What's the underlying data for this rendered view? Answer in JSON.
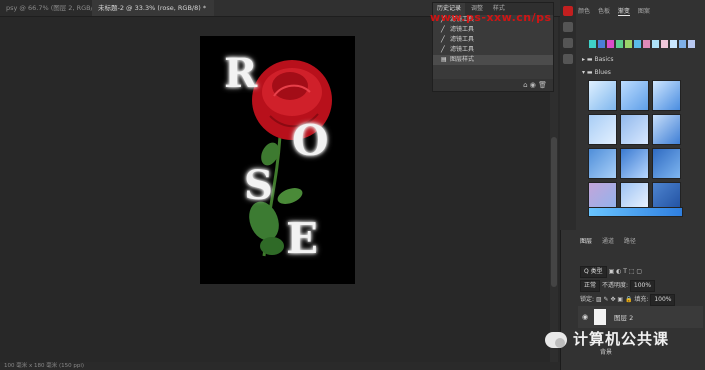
{
  "tabs": [
    "psy @ 66.7% (图层 2, RGB/8#)",
    "未标题-2 @ 33.3% (rose, RGB/8) *"
  ],
  "status": "100 毫米 x 180 毫米 (150 ppi)",
  "watermark": "www.ps-xxw.cn/ps",
  "history": {
    "tabs": [
      "历史记录",
      "调整",
      "样式"
    ],
    "items": [
      "滤镜工具",
      "滤镜工具",
      "滤镜工具",
      "滤镜工具"
    ],
    "selected": "图层样式",
    "footer": "⌂ ◉ 🗑"
  },
  "swatches": {
    "tabs": [
      "颜色",
      "色板",
      "渐变",
      "图案"
    ],
    "folders": [
      "Basics",
      "Blues"
    ]
  },
  "layers": {
    "tabs": [
      "图层",
      "通道",
      "路径"
    ],
    "kind_label": "Q 类型",
    "mode": "正常",
    "opacity_label": "不透明度:",
    "opacity": "100%",
    "lock_label": "锁定:",
    "fill_label": "填充:",
    "fill": "100%",
    "layer_name": "图层 2",
    "layer_bg": "背景"
  },
  "doc": {
    "letters": [
      "R",
      "O",
      "S",
      "E"
    ]
  },
  "footer_brand": "计算机公共课"
}
